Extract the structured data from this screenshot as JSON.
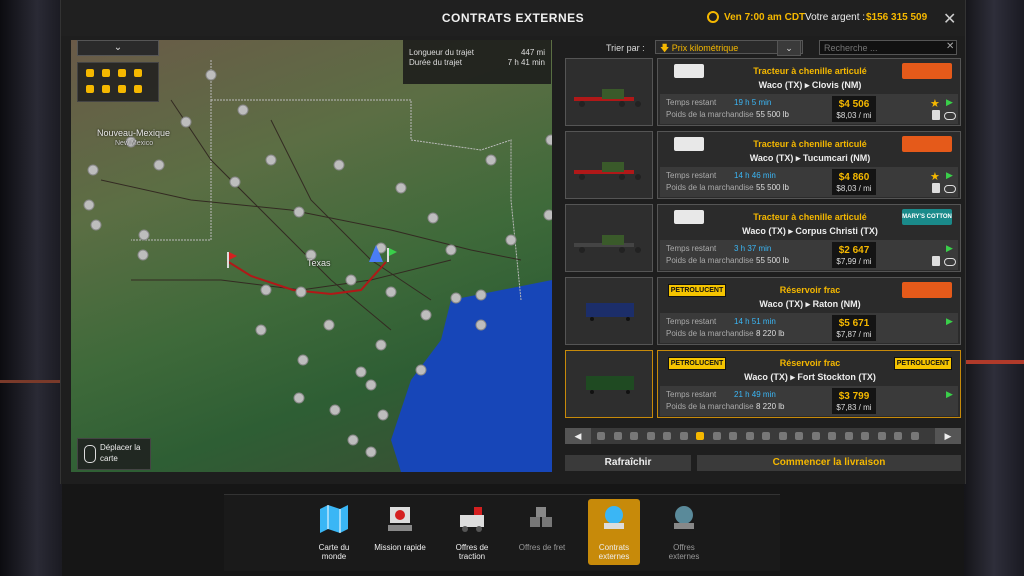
{
  "window": {
    "title": "CONTRATS EXTERNES",
    "time": "Ven 7:00 am CDT",
    "money_label": "Votre argent :",
    "money_value": "$156 315 509"
  },
  "map": {
    "route_length_label": "Longueur du trajet",
    "route_length_value": "447 mi",
    "route_duration_label": "Durée du trajet",
    "route_duration_value": "7 h 41 min",
    "region_new_mexico": "Nouveau-Mexique",
    "region_new_mexico_sub": "New Mexico",
    "region_texas": "Texas",
    "move_hint": "Déplacer la carte"
  },
  "sort": {
    "label": "Trier par :",
    "selected": "Prix kilométrique",
    "search_placeholder": "Recherche ..."
  },
  "jobs": [
    {
      "cargo": "Tracteur à chenille articulé",
      "route": "Waco (TX) ▸ Clovis (NM)",
      "time": "19 h 5 min",
      "weight": "55 500 lb",
      "price": "$4 506",
      "per_mile": "$8,03 / mi",
      "time_label": "Temps restant",
      "weight_label": "Poids de la marchandise",
      "source_logo": "ghosts-logo",
      "dest_logo": "bnsf-logo"
    },
    {
      "cargo": "Tracteur à chenille articulé",
      "route": "Waco (TX) ▸ Tucumcari (NM)",
      "time": "14 h 46 min",
      "weight": "55 500 lb",
      "price": "$4 860",
      "per_mile": "$8,03 / mi",
      "time_label": "Temps restant",
      "weight_label": "Poids de la marchandise",
      "source_logo": "ghosts-logo",
      "dest_logo": "bnsf-logo"
    },
    {
      "cargo": "Tracteur à chenille articulé",
      "route": "Waco (TX) ▸ Corpus Christi (TX)",
      "time": "3 h 37 min",
      "weight": "55 500 lb",
      "price": "$2 647",
      "per_mile": "$7,99 / mi",
      "time_label": "Temps restant",
      "weight_label": "Poids de la marchandise",
      "source_logo": "ghosts-logo",
      "dest_logo": "marys-cotton-logo",
      "dest_text": "MARY'S COTTON"
    },
    {
      "cargo": "Réservoir frac",
      "route": "Waco (TX) ▸ Raton (NM)",
      "time": "14 h 51 min",
      "weight": "8 220 lb",
      "price": "$5 671",
      "per_mile": "$7,87 / mi",
      "time_label": "Temps restant",
      "weight_label": "Poids de la marchandise",
      "source_logo": "petrolucent-logo",
      "source_text": "PETROLUCENT",
      "dest_logo": "bnsf-logo"
    },
    {
      "cargo": "Réservoir frac",
      "route": "Waco (TX) ▸ Fort Stockton (TX)",
      "time": "21 h 49 min",
      "weight": "8 220 lb",
      "price": "$3 799",
      "per_mile": "$7,83 / mi",
      "time_label": "Temps restant",
      "weight_label": "Poids de la marchandise",
      "source_logo": "petrolucent-logo",
      "source_text": "PETROLUCENT",
      "dest_logo": "petrolucent-logo",
      "dest_text": "PETROLUCENT"
    }
  ],
  "pager": {
    "current_page": 7,
    "total_pages": 20
  },
  "actions": {
    "refresh": "Rafraîchir",
    "start": "Commencer la livraison"
  },
  "dock": [
    {
      "label": "Carte du monde",
      "icon": "world-map-icon",
      "active": false,
      "dim": false
    },
    {
      "label": "Mission rapide",
      "icon": "quick-job-icon",
      "active": false,
      "dim": false
    },
    {
      "label": "Offres de traction",
      "icon": "freight-market-icon",
      "active": false,
      "dim": false
    },
    {
      "label": "Offres de fret",
      "icon": "cargo-market-icon",
      "active": false,
      "dim": true
    },
    {
      "label": "Contrats externes",
      "icon": "external-contracts-icon",
      "active": true,
      "dim": false
    },
    {
      "label": "Offres externes",
      "icon": "external-offers-icon",
      "active": false,
      "dim": true
    }
  ],
  "colors": {
    "accent": "#f5b800",
    "time": "#3ab6f5",
    "selected_border": "#c78a0a",
    "dock_active": "#c78a0a"
  }
}
